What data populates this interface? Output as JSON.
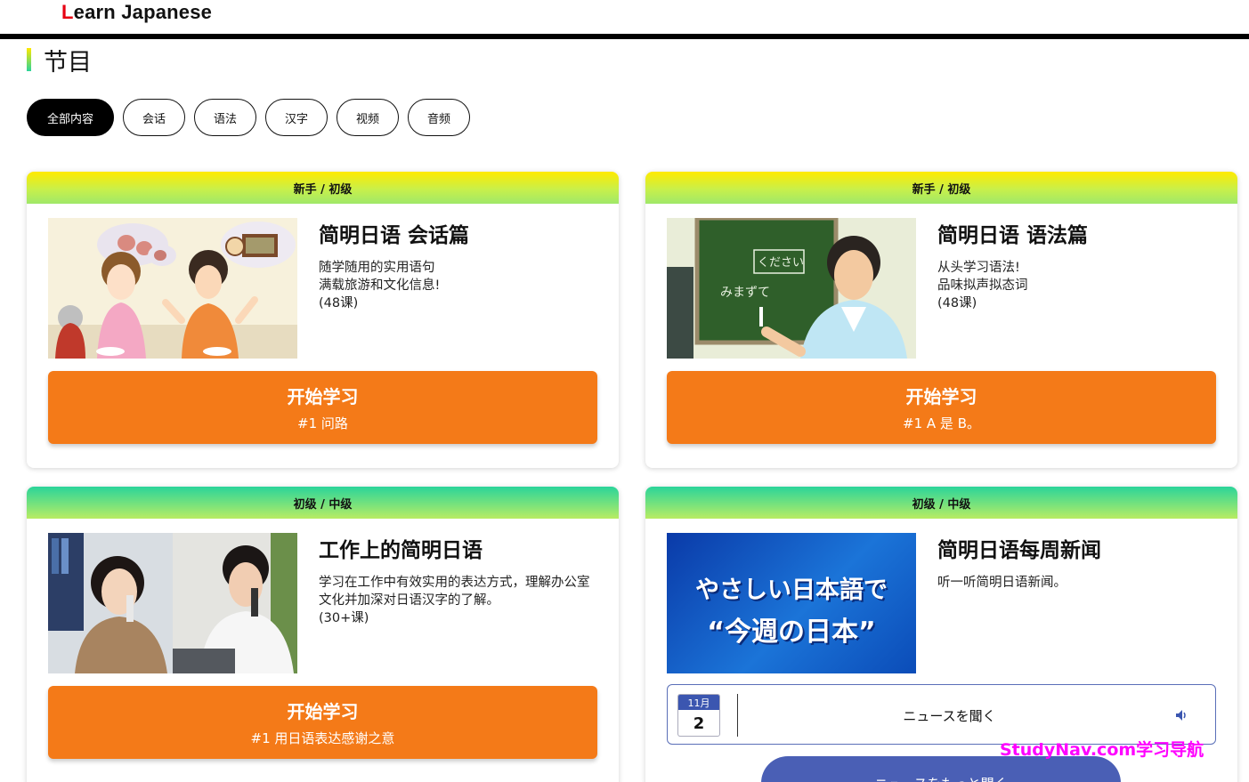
{
  "header": {
    "logo_first": "L",
    "logo_rest": "earn Japanese"
  },
  "section": {
    "title": "节目"
  },
  "filters": [
    {
      "label": "全部内容",
      "active": true
    },
    {
      "label": "会话"
    },
    {
      "label": "语法"
    },
    {
      "label": "汉字"
    },
    {
      "label": "视频"
    },
    {
      "label": "音频"
    }
  ],
  "cards": [
    {
      "level": "新手 / 初级",
      "title": "简明日语 会话篇",
      "desc1": "随学随用的实用语句",
      "desc2": "满载旅游和文化信息!",
      "count": "(48课)",
      "button_main": "开始学习",
      "button_sub": "#1 问路"
    },
    {
      "level": "新手 / 初级",
      "title": "简明日语 语法篇",
      "desc1": "从头学习语法!",
      "desc2": "品味拟声拟态词",
      "count": "(48课)",
      "button_main": "开始学习",
      "button_sub": "#1 A 是 B。",
      "board_text1": "みまずて",
      "board_text2": "ください"
    },
    {
      "level": "初级 / 中级",
      "title": "工作上的简明日语",
      "desc1": "学习在工作中有效实用的表达方式，理解办公室文化并加深对日语汉字的了解。",
      "count": "(30+课)",
      "button_main": "开始学习",
      "button_sub": "#1 用日语表达感谢之意"
    },
    {
      "level": "初级 / 中级",
      "title": "简明日语每周新闻",
      "desc1": "听一听简明日语新闻。",
      "thumb_line1": "やさしい日本語で",
      "thumb_line2": "“今週の日本”",
      "calendar_month": "11月",
      "calendar_day": "2",
      "news_label": "ニュースを聞く",
      "more_label": "ニュースをもっと聞く"
    }
  ],
  "watermark": "StudyNav.com学习导航",
  "colors": {
    "accent_orange": "#f47a18",
    "news_blue": "#4a5fb5",
    "logo_red": "#e60012"
  }
}
